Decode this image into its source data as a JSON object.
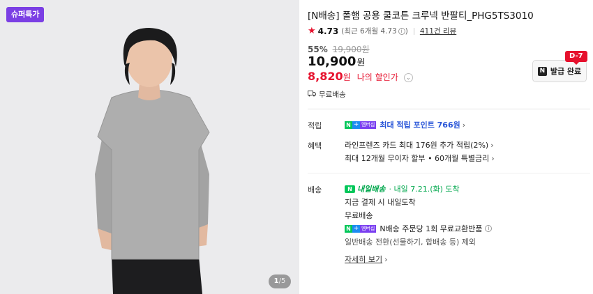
{
  "gallery": {
    "badge": "슈퍼특가",
    "page_current": "1",
    "page_sep": "/",
    "page_total": "5"
  },
  "product": {
    "title": "[N배송] 폴햄 공용 쿨코튼 크루넥 반팔티_PHG5TS3010",
    "rating": "4.73",
    "rating_recent": "(최근 6개월 4.73",
    "rating_recent_close": ")",
    "reviews": "411건 리뷰",
    "discount_rate": "55%",
    "original_price": "19,900원",
    "price": "10,900",
    "price_unit": "원",
    "my_price": "8,820",
    "my_price_unit": "원",
    "my_price_label": "나의 할인가",
    "free_shipping": "무료배송"
  },
  "coupon": {
    "dday": "D-7",
    "label": "발급 완료",
    "logo": "N"
  },
  "membership": {
    "n": "N",
    "plus": "+",
    "mem": "멤버십"
  },
  "rows": {
    "points_label": "적립",
    "points_text": "최대 적립 포인트 766원",
    "benefit_label": "혜택",
    "benefit_1": "라인프렌즈 카드 최대 176원 추가 적립(2%)",
    "benefit_2": "최대 12개월 무이자 할부 • 60개월 특별금리",
    "delivery_label": "배송",
    "tomorrow_icon": "N",
    "tomorrow": "내일배송",
    "tomorrow_date": "· 내일 7.21.(화) 도착",
    "delivery_1": "지금 결제 시 내일도착",
    "delivery_2": "무료배송",
    "delivery_3": "N배송 주문당 1회 무료교환반품",
    "delivery_4": "일반배송 전환(선물하기, 합배송 등) 제외",
    "details": "자세히 보기"
  },
  "icons": [
    "star-icon",
    "info-icon",
    "chevron-down-icon",
    "truck-icon",
    "chevron-right-icon"
  ],
  "colors": {
    "accent_red": "#e6112d",
    "badge_purple": "#7b3fe4",
    "naver_green": "#03c75a",
    "point_blue": "#2b57d8"
  }
}
